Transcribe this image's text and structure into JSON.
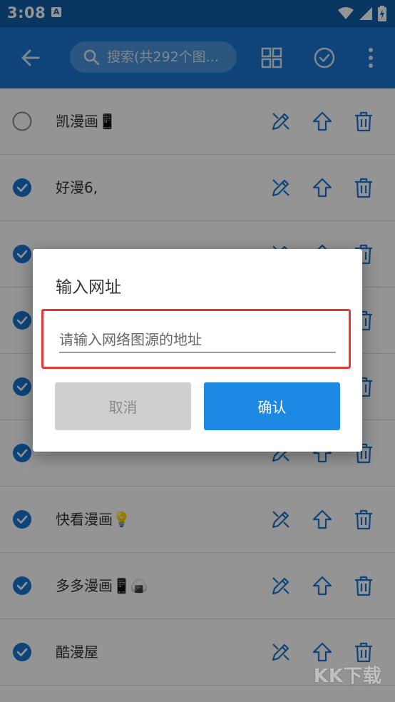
{
  "status_bar": {
    "time": "3:08",
    "notif_icon": "A"
  },
  "toolbar": {
    "search_placeholder": "搜索(共292个图..."
  },
  "sources": [
    {
      "name": "凯漫画",
      "emoji": "📱",
      "checked": false
    },
    {
      "name": "好漫6,",
      "emoji": "",
      "checked": true
    },
    {
      "name": "",
      "emoji": "",
      "checked": true
    },
    {
      "name": "",
      "emoji": "",
      "checked": true
    },
    {
      "name": "",
      "emoji": "",
      "checked": true
    },
    {
      "name": "",
      "emoji": "",
      "checked": true
    },
    {
      "name": "快看漫画",
      "emoji": "💡",
      "checked": true
    },
    {
      "name": "多多漫画",
      "emoji": "📱🍙",
      "checked": true
    },
    {
      "name": "酷漫屋",
      "emoji": "",
      "checked": true
    }
  ],
  "dialog": {
    "title": "输入网址",
    "input_placeholder": "请输入网络图源的地址",
    "input_value": "",
    "cancel_label": "取消",
    "confirm_label": "确认"
  },
  "watermark": "KK下载",
  "colors": {
    "primary": "#1976d2",
    "status_bar": "#0f5fa8",
    "icon_blue": "#1976d2",
    "highlight": "#e53935",
    "confirm_button": "#1e88e5",
    "cancel_button": "#cfcfcf"
  }
}
